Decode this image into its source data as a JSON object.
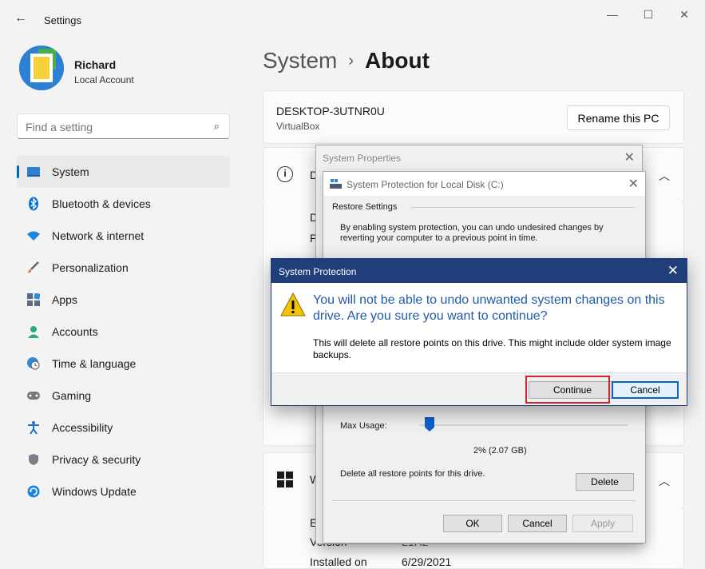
{
  "window": {
    "title": "Settings",
    "back": "←",
    "minimize": "—",
    "maximize": "☐",
    "close": "✕"
  },
  "user": {
    "name": "Richard",
    "account": "Local Account"
  },
  "search": {
    "placeholder": "Find a setting"
  },
  "sidebar": {
    "items": [
      {
        "label": "System",
        "icon": "system-icon",
        "active": true
      },
      {
        "label": "Bluetooth & devices",
        "icon": "bluetooth-icon"
      },
      {
        "label": "Network & internet",
        "icon": "wifi-icon"
      },
      {
        "label": "Personalization",
        "icon": "brush-icon"
      },
      {
        "label": "Apps",
        "icon": "apps-icon"
      },
      {
        "label": "Accounts",
        "icon": "person-icon"
      },
      {
        "label": "Time & language",
        "icon": "globe-clock-icon"
      },
      {
        "label": "Gaming",
        "icon": "gamepad-icon"
      },
      {
        "label": "Accessibility",
        "icon": "accessibility-icon"
      },
      {
        "label": "Privacy & security",
        "icon": "shield-icon"
      },
      {
        "label": "Windows Update",
        "icon": "update-icon"
      }
    ]
  },
  "breadcrumb": {
    "parent": "System",
    "separator": "›",
    "current": "About"
  },
  "device": {
    "name": "DESKTOP-3UTNR0U",
    "model": "VirtualBox",
    "rename_label": "Rename this PC"
  },
  "background_fragments": {
    "d1": "D",
    "d2": "D",
    "p1": "P",
    "w1": "W",
    "ed": "Ed",
    "version_label": "Version",
    "version_value": "21H2",
    "installed_label": "Installed on",
    "installed_value": "6/29/2021"
  },
  "system_properties": {
    "title": "System Properties",
    "close": "✕"
  },
  "protection_dialog": {
    "title": "System Protection for Local Disk (C:)",
    "close": "✕",
    "restore_heading": "Restore Settings",
    "restore_desc": "By enabling system protection, you can undo undesired changes by reverting your computer to a previous point in time.",
    "max_usage_label": "Max Usage:",
    "max_usage_fraction": 0.02,
    "usage_value": "2% (2.07 GB)",
    "delete_desc": "Delete all restore points for this drive.",
    "delete_label": "Delete",
    "ok_label": "OK",
    "cancel_label": "Cancel",
    "apply_label": "Apply"
  },
  "confirm_dialog": {
    "title": "System Protection",
    "close": "✕",
    "main_text": "You will not be able to undo unwanted system changes on this drive. Are you sure you want to continue?",
    "sub_text": "This will delete all restore points on this drive. This might include older system image backups.",
    "continue_label": "Continue",
    "cancel_label": "Cancel"
  },
  "colors": {
    "accent": "#0067c0",
    "dialog_bar": "#1f3e7a",
    "highlight": "#d4242b",
    "warning": "#f5c400"
  }
}
